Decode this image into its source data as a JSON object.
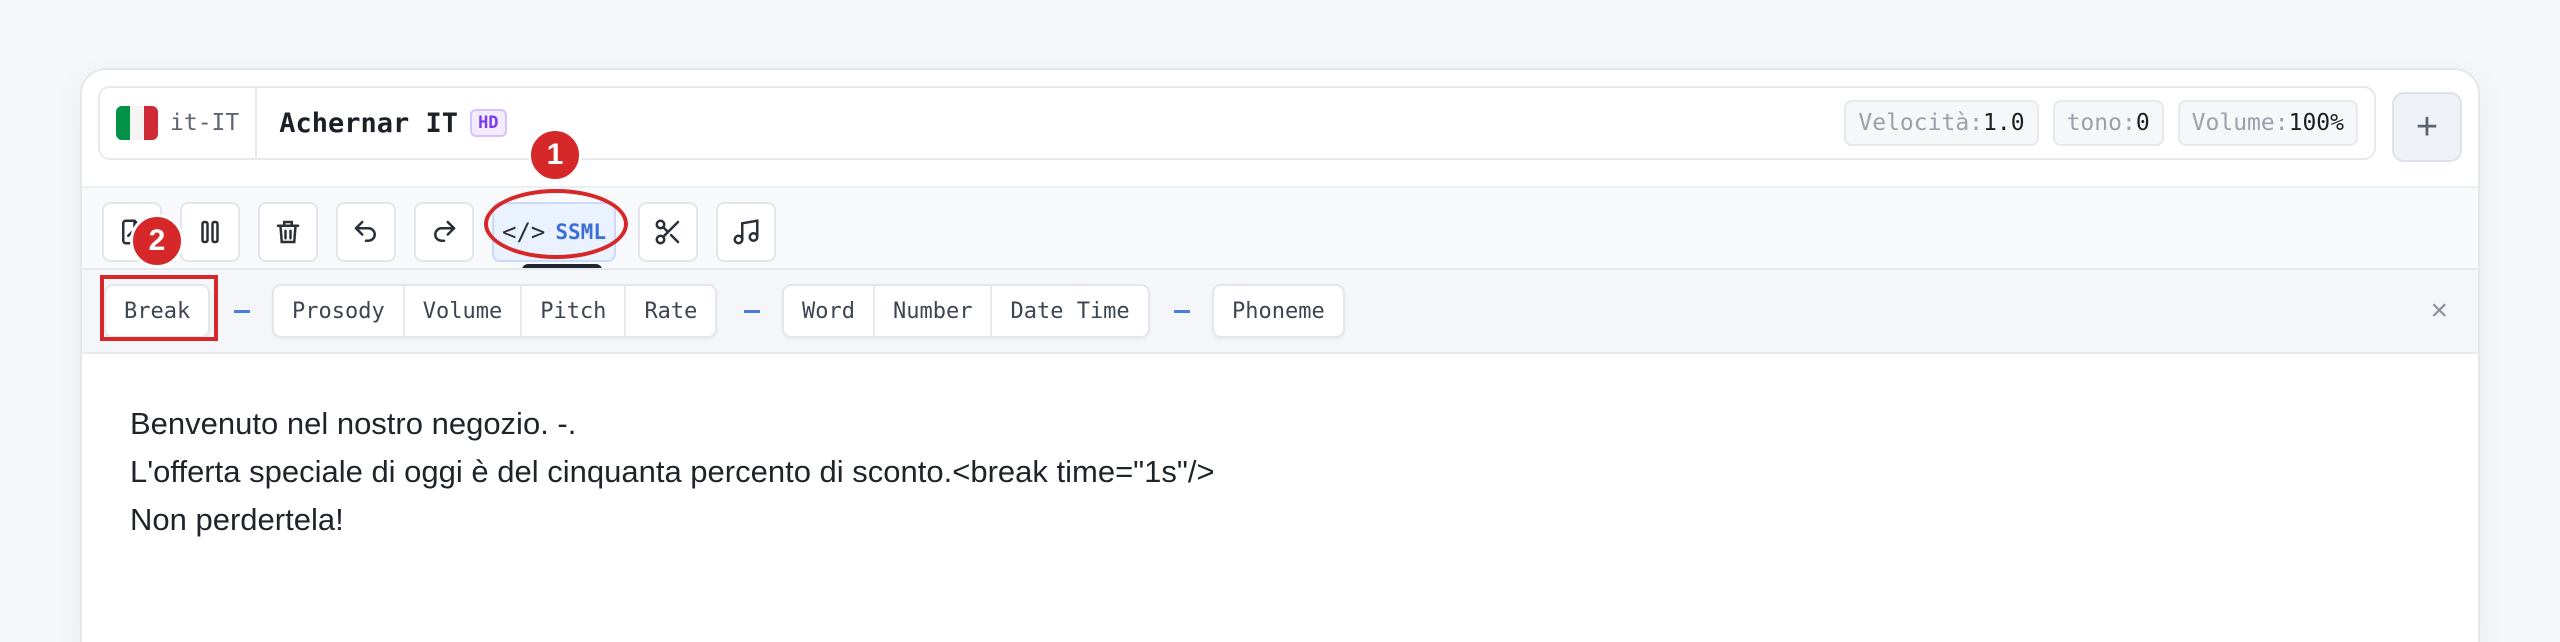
{
  "voice": {
    "lang_code": "it-IT",
    "name": "Achernar IT",
    "badge": "HD",
    "flag_colors": [
      "#009246",
      "#ffffff",
      "#ce2b37"
    ]
  },
  "params": [
    {
      "label": "Velocità:",
      "value": "1.0"
    },
    {
      "label": "tono:",
      "value": "0"
    },
    {
      "label": "Volume:",
      "value": "100%"
    }
  ],
  "header": {
    "add_label": "+"
  },
  "toolbar": {
    "buttons": [
      "import-icon",
      "pause-icon",
      "trash-icon",
      "undo-icon",
      "redo-icon",
      "code-icon",
      "scissors-icon",
      "music-note-icon"
    ],
    "ssml_label": "SSML",
    "ssml_icon": "</>"
  },
  "ssml_tags": {
    "group1": [
      "Break"
    ],
    "group2": [
      "Prosody",
      "Volume",
      "Pitch",
      "Rate"
    ],
    "group3": [
      "Word",
      "Number",
      "Date Time"
    ],
    "group4": [
      "Phoneme"
    ],
    "close": "×"
  },
  "editor": {
    "lines": [
      "Benvenuto nel nostro negozio. -.",
      "L'offerta speciale di oggi è del cinquanta percento di sconto.<break time=\"1s\"/>",
      "Non perdertela!"
    ]
  },
  "annotations": {
    "badge1": "1",
    "badge2": "2",
    "color": "#d62828"
  }
}
